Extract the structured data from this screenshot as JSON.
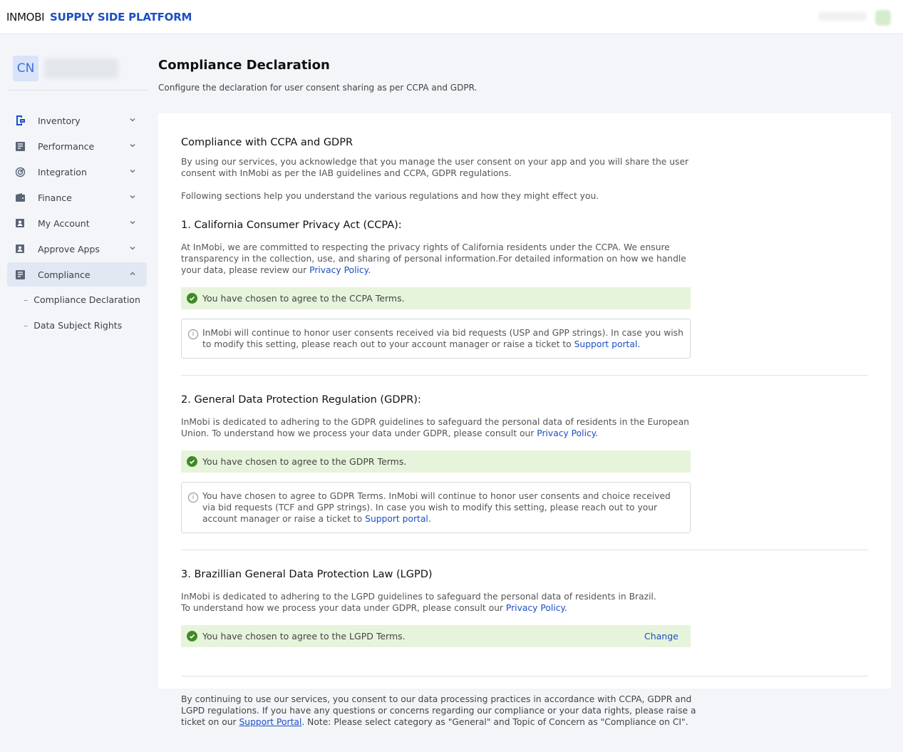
{
  "header": {
    "brand_company": "INMOBI",
    "brand_product": "SUPPLY SIDE PLATFORM"
  },
  "sidebar": {
    "avatar_initials": "CN",
    "items": [
      {
        "label": "Inventory",
        "icon": "inventory-icon",
        "expanded": false
      },
      {
        "label": "Performance",
        "icon": "performance-icon",
        "expanded": false
      },
      {
        "label": "Integration",
        "icon": "integration-icon",
        "expanded": false
      },
      {
        "label": "Finance",
        "icon": "wallet-icon",
        "expanded": false
      },
      {
        "label": "My Account",
        "icon": "account-icon",
        "expanded": false
      },
      {
        "label": "Approve Apps",
        "icon": "approve-icon",
        "expanded": false
      },
      {
        "label": "Compliance",
        "icon": "compliance-icon",
        "expanded": true
      }
    ],
    "subitems": [
      {
        "label": "Compliance Declaration",
        "dash": "–"
      },
      {
        "label": "Data Subject Rights",
        "dash": "–"
      }
    ]
  },
  "page": {
    "title": "Compliance Declaration",
    "subtitle": "Configure the declaration for user consent sharing as per CCPA and GDPR."
  },
  "intro": {
    "heading": "Compliance with CCPA and GDPR",
    "para1": "By using our services, you acknowledge that you manage the user consent on your app and you will share the user consent with InMobi as per the IAB guidelines and CCPA, GDPR regulations.",
    "para2": "Following sections help you understand the various regulations and how they might effect you."
  },
  "ccpa": {
    "heading": "1. California Consumer Privacy Act (CCPA):",
    "para": "At InMobi, we are committed to respecting the privacy rights of California residents under the CCPA. We ensure transparency in the collection, use, and sharing of personal information.For detailed information on how we handle your data, please review our ",
    "link": "Privacy Policy.",
    "notice": "You have chosen to agree to the CCPA Terms.",
    "info": "InMobi will continue to honor user consents received via bid requests (USP and GPP strings). In case you wish to modify this setting, please reach out to your account manager or raise a ticket to ",
    "info_link": "Support portal."
  },
  "gdpr": {
    "heading": "2. General Data Protection Regulation (GDPR):",
    "para": "InMobi is dedicated to adhering to the GDPR guidelines to safeguard the personal data of residents in the European Union. To understand how we process your data under GDPR, please consult our ",
    "link": "Privacy Policy.",
    "notice": "You have chosen to agree to the GDPR Terms.",
    "info": "You have chosen to agree to GDPR Terms. InMobi will continue to honor user consents and choice received via bid requests (TCF and GPP strings). In case you wish to modify this setting, please reach out to your account manager or raise a ticket to ",
    "info_link": "Support portal."
  },
  "lgpd": {
    "heading": "3. Brazillian General Data Protection Law (LGPD)",
    "para_line1": "InMobi is dedicated to adhering to the LGPD guidelines to safeguard the personal data of residents in Brazil.",
    "para_line2": "To understand how we process your data under GDPR, please consult our ",
    "link": "Privacy Policy.",
    "notice": "You have chosen to agree to the LGPD Terms.",
    "change_label": "Change"
  },
  "footer": {
    "text1": "By continuing to use our services, you consent to our data processing practices in accordance with CCPA, GDPR and LGPD regulations. If you have any questions or concerns regarding our compliance or your data rights, please raise a ticket on our ",
    "link": "Support Portal",
    "text2": ". Note: Please select category as \"General\" and Topic of Concern as \"Compliance on CI\"."
  },
  "colors": {
    "brand_blue": "#1c4fc2",
    "success_bg": "#e7f4dc",
    "success_icon": "#3f8a27",
    "active_nav_bg": "#e1e8f3"
  }
}
